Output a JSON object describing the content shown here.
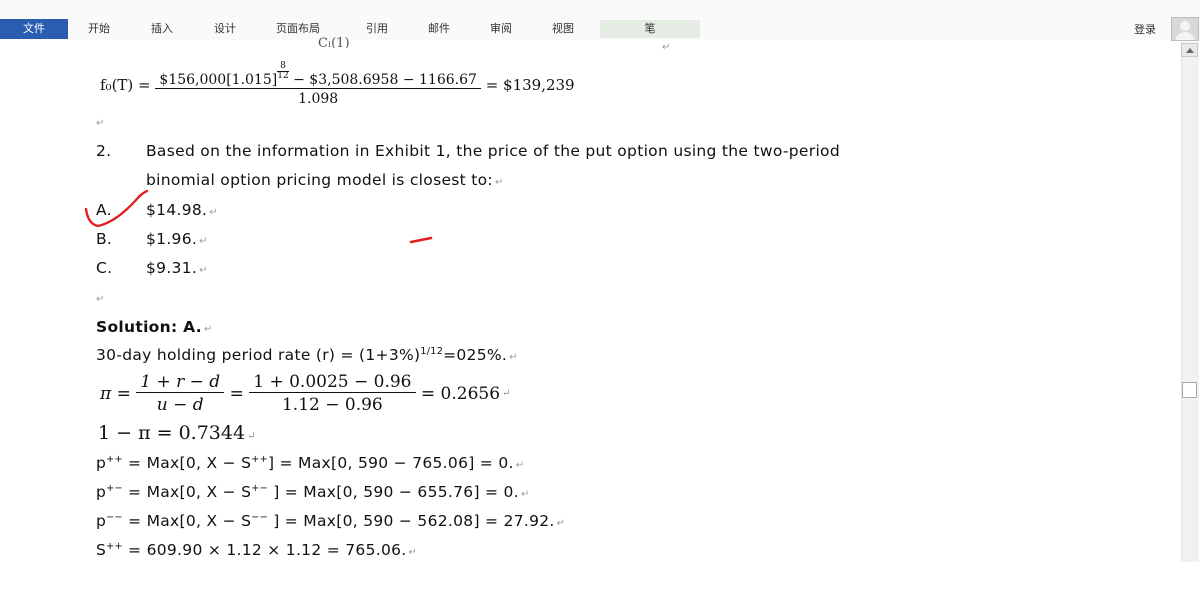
{
  "ribbon": {
    "tabs": [
      "文件",
      "开始",
      "插入",
      "设计",
      "页面布局",
      "引用",
      "邮件",
      "审阅",
      "视图",
      "笔"
    ],
    "login": "登录"
  },
  "doc": {
    "top_fragment": "Cₗ(1)",
    "formula_f0": {
      "lhs": "f₀(T) =",
      "numerator_a": "$156,000[1.015]",
      "exponent_top": "8",
      "exponent_bottom": "12",
      "numerator_b": " − $3,508.6958 − 1166.67",
      "denominator": "1.098",
      "result": "= $139,239"
    },
    "question": {
      "number": "2.",
      "line1": "Based on the information in Exhibit 1, the price of the put option using the two-period",
      "line2": "binomial option pricing model is closest to:"
    },
    "options": [
      {
        "letter": "A.",
        "text": "$14.98."
      },
      {
        "letter": "B.",
        "text": "$1.96."
      },
      {
        "letter": "C.",
        "text": "$9.31."
      }
    ],
    "solution_title": "Solution: A.",
    "holding_rate": {
      "text": "30-day holding period rate (r) = (1+3%)",
      "exp": "1/12",
      "tail": "=025%."
    },
    "pi_formula": {
      "lhs": "π =",
      "num1": "1 + r − d",
      "den1": "u − d",
      "eq": "=",
      "num2": "1 + 0.0025 − 0.96",
      "den2": "1.12 − 0.96",
      "result": "= 0.2656"
    },
    "one_minus_pi": "1 − π = 0.7344",
    "p_lines": [
      {
        "base": "p",
        "sup": "++",
        "text": " = Max[0, X − S",
        "sup2": "++",
        "tail": "] = Max[0, 590 − 765.06] = 0."
      },
      {
        "base": "p",
        "sup": "+−",
        "text": " = Max[0, X − S",
        "sup2": "+−",
        "tail": " ] = Max[0, 590 − 655.76] = 0."
      },
      {
        "base": "p",
        "sup": "−−",
        "text": " = Max[0, X − S",
        "sup2": "−−",
        "tail": " ] = Max[0, 590 − 562.08] = 27.92."
      }
    ],
    "s_line": {
      "base": "S",
      "sup": "++",
      "text": " = 609.90 × 1.12 × 1.12 = 765.06."
    }
  },
  "colors": {
    "file_tab": "#2a5db0",
    "annotation_red": "#e02020"
  },
  "icons": [
    "scroll-up-arrow-icon",
    "user-avatar-icon",
    "paragraph-mark-icon"
  ]
}
